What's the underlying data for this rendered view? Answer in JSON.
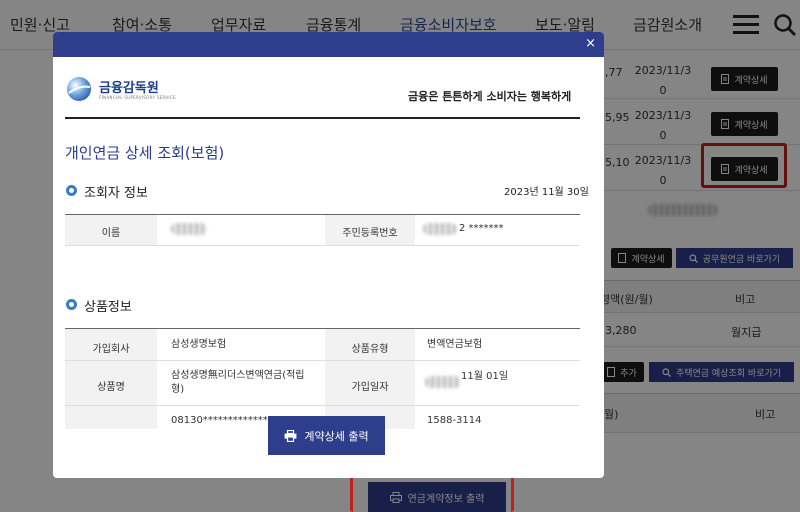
{
  "topnav": {
    "items": [
      "민원·신고",
      "참여·소통",
      "업무자료",
      "금융통계",
      "금융소비자보호",
      "보도·알림",
      "금감원소개"
    ]
  },
  "background": {
    "rows": [
      {
        "amount": ",77",
        "date_line1": "2023/11/3",
        "date_line2": "0",
        "button": "계약상세"
      },
      {
        "amount": "5,95",
        "date_line1": "2023/11/3",
        "date_line2": "0",
        "button": "계약상세"
      },
      {
        "amount": "5,10",
        "date_line1": "2023/11/3",
        "date_line2": "0",
        "button": "계약상세"
      }
    ],
    "btn_contract_small": "계약상세",
    "btn_public_pension": "공무원연금 바로가기",
    "col_amount_header": "령액(원/월)",
    "col_note_header": "비고",
    "amount_value": "3,280",
    "note_value": "월지급",
    "btn_add": "추가",
    "btn_housing_pension": "주택연금 예상조회 바로가기",
    "col_header_3": "월)",
    "col_note_header_2": "비고",
    "bottom_button": "연금계약정보 출력"
  },
  "modal": {
    "close": "×",
    "logo_name": "금융감독원",
    "logo_sub": "FINANCIAL SUPERVISORY SERVICE",
    "slogan": "금융은 튼튼하게 소비자는 행복하게",
    "title": "개인연금 상세 조회(보험)",
    "section1": {
      "title": "조회자 정보",
      "date": "2023년 11월 30일",
      "name_label": "이름",
      "id_label": "주민등록번호",
      "id_value": "2 *******"
    },
    "section2": {
      "title": "상품정보",
      "company_label": "가입회사",
      "company_value": "삼성생명보험",
      "type_label": "상품유형",
      "type_value": "변액연금보험",
      "product_label": "상품명",
      "product_value_line1": "삼성생명無리더스변액연금(적립",
      "product_value_line2": "형)",
      "join_label": "가입일자",
      "join_value": "11월 01일",
      "contract_no": "08130***********************",
      "phone": "1588-3114"
    },
    "print_button": "계약상세 출력"
  },
  "colors": {
    "navy": "#2e3e8c",
    "highlight_red": "#c0221b",
    "bullet_blue": "#3b7ac4"
  }
}
